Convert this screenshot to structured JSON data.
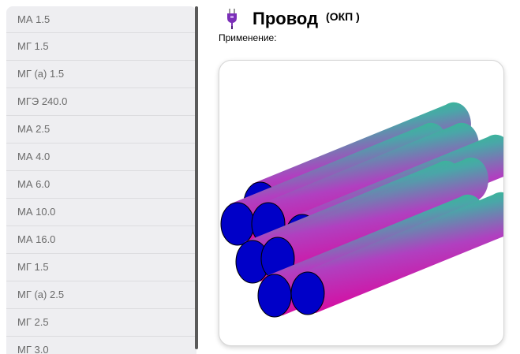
{
  "sidebar": {
    "items": [
      {
        "label": "МА 1.5"
      },
      {
        "label": "МГ 1.5"
      },
      {
        "label": "МГ (а) 1.5"
      },
      {
        "label": "МГЭ 240.0"
      },
      {
        "label": "МА 2.5"
      },
      {
        "label": "МА 4.0"
      },
      {
        "label": "МА 6.0"
      },
      {
        "label": "МА 10.0"
      },
      {
        "label": "МА 16.0"
      },
      {
        "label": "МГ 1.5"
      },
      {
        "label": "МГ (а) 2.5"
      },
      {
        "label": "МГ 2.5"
      },
      {
        "label": "МГ 3.0"
      }
    ]
  },
  "header": {
    "icon": "plug-icon",
    "title": "Провод",
    "subtitle": "(ОКП )"
  },
  "main": {
    "usage_label": "Применение:",
    "image": "wire-bundle-3d",
    "colors": {
      "end_cap": "#0000c8",
      "gradient_green": "#00ee66",
      "gradient_magenta": "#e0009a"
    }
  }
}
